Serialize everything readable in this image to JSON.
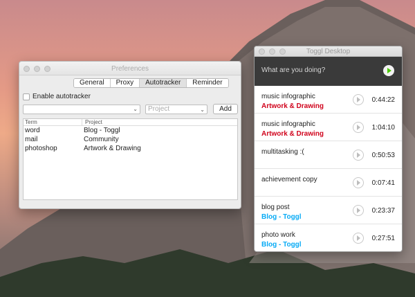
{
  "colors": {
    "artwork_project": "#d0021b",
    "blog_project": "#06aaf5",
    "timer_bar": "#3a3a3a",
    "play_green": "#4bc800"
  },
  "preferences": {
    "title": "Preferences",
    "tabs": [
      {
        "label": "General",
        "active": false
      },
      {
        "label": "Proxy",
        "active": false
      },
      {
        "label": "Autotracker",
        "active": true
      },
      {
        "label": "Reminder",
        "active": false
      }
    ],
    "enable_autotracker": {
      "label": "Enable autotracker",
      "checked": false
    },
    "term_input": {
      "value": ""
    },
    "project_select": {
      "placeholder": "Project"
    },
    "add_label": "Add",
    "table": {
      "headers": [
        "Term",
        "Project"
      ],
      "rows": [
        {
          "term": "word",
          "project": "Blog - Toggl"
        },
        {
          "term": "mail",
          "project": "Community"
        },
        {
          "term": "photoshop",
          "project": "Artwork & Drawing"
        }
      ]
    }
  },
  "toggl": {
    "title": "Toggl Desktop",
    "timer_placeholder": "What are you doing?",
    "icons": {
      "start": "play-icon",
      "continue": "play-icon"
    },
    "entries": [
      {
        "description": "music infographic",
        "project": "Artwork & Drawing",
        "project_color": "#d0021b",
        "duration": "0:44:22"
      },
      {
        "description": "music infographic",
        "project": "Artwork & Drawing",
        "project_color": "#d0021b",
        "duration": "1:04:10"
      },
      {
        "description": "multitasking :(",
        "project": "",
        "project_color": "",
        "duration": "0:50:53"
      },
      {
        "description": "achievement copy",
        "project": "",
        "project_color": "",
        "duration": "0:07:41"
      },
      {
        "description": "blog post",
        "project": "Blog - Toggl",
        "project_color": "#06aaf5",
        "duration": "0:23:37"
      },
      {
        "description": "photo work",
        "project": "Blog - Toggl",
        "project_color": "#06aaf5",
        "duration": "0:27:51"
      }
    ]
  }
}
